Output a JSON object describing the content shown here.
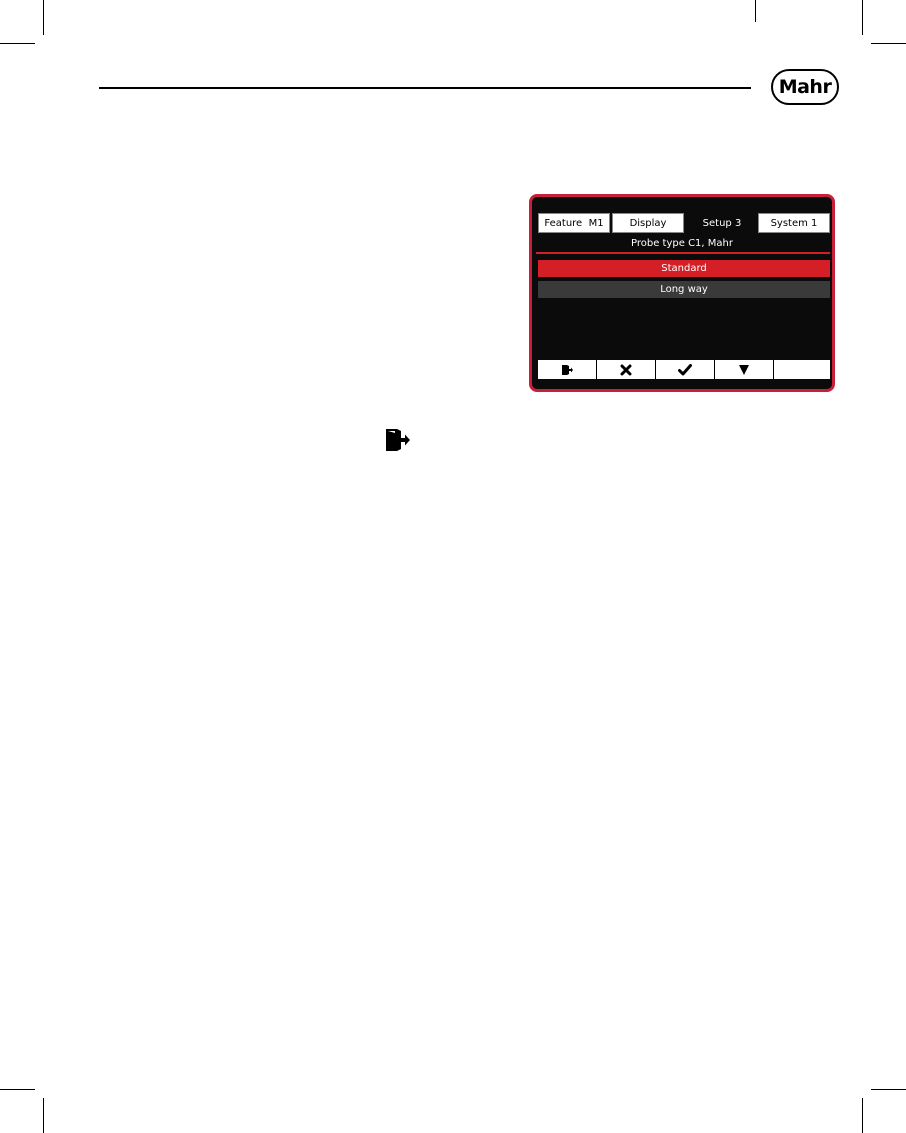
{
  "header": {
    "logo_text": "Mahr"
  },
  "screen": {
    "tabs": [
      {
        "label": "Feature  M1",
        "active": false
      },
      {
        "label": "Display",
        "active": false
      },
      {
        "label": "Setup 3",
        "active": true
      },
      {
        "label": "System 1",
        "active": false
      }
    ],
    "title": "Probe type C1, Mahr",
    "options": [
      {
        "label": "Standard",
        "selected": true
      },
      {
        "label": "Long way",
        "selected": false
      }
    ],
    "softkeys": [
      "exit-icon",
      "close-icon",
      "check-icon",
      "arrow-down-icon",
      "blank"
    ]
  },
  "body_icon": "exit-icon",
  "colors": {
    "accent": "#d41f26",
    "frame": "#c8203a",
    "screen_bg": "#0b0b0b"
  }
}
